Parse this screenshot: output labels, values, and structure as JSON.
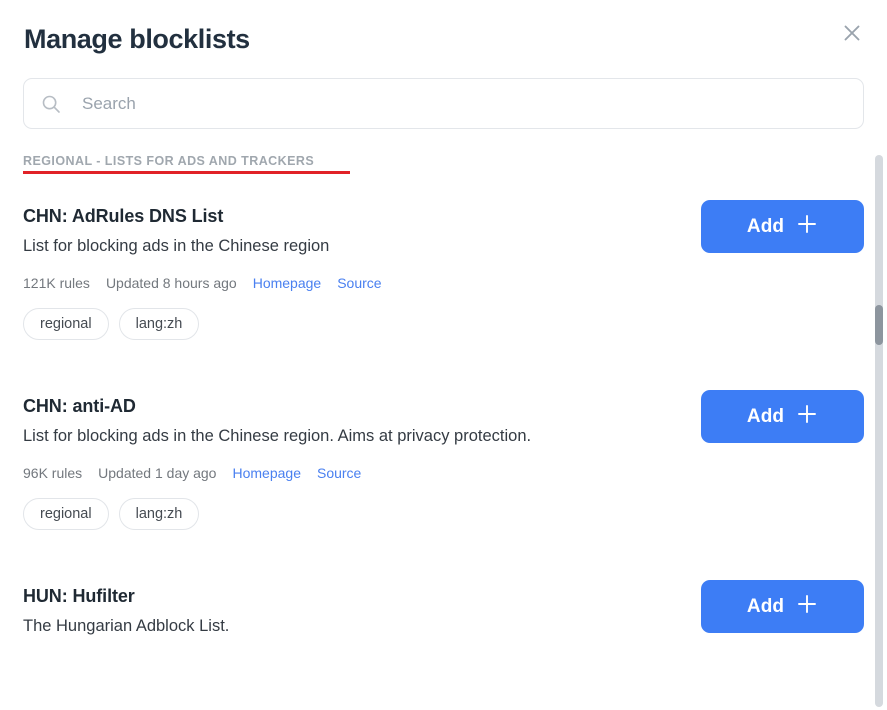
{
  "dialog": {
    "title": "Manage blocklists",
    "close_icon": "close-icon"
  },
  "search": {
    "icon": "search-icon",
    "placeholder": "Search",
    "value": ""
  },
  "section": {
    "label": "REGIONAL - LISTS FOR ADS AND TRACKERS",
    "underline_color": "#e12228"
  },
  "colors": {
    "accent_blue": "#3d7df5",
    "link_blue": "#4a80f0",
    "title_navy": "#22303f",
    "muted_gray": "#73787e",
    "section_gray": "#a0a7ae",
    "red_underline": "#e12228",
    "scrollbar_track": "#d5d9de",
    "scrollbar_thumb": "#8d959e"
  },
  "buttons": {
    "add_label": "Add",
    "add_icon": "plus-icon"
  },
  "lists": [
    {
      "title": "CHN: AdRules DNS List",
      "description": "List for blocking ads in the Chinese region",
      "rules": "121K rules",
      "updated": "Updated 8 hours ago",
      "homepage_label": "Homepage",
      "source_label": "Source",
      "tags": [
        "regional",
        "lang:zh"
      ],
      "action_label": "Add"
    },
    {
      "title": "CHN: anti-AD",
      "description": "List for blocking ads in the Chinese region. Aims at privacy protection.",
      "rules": "96K rules",
      "updated": "Updated 1 day ago",
      "homepage_label": "Homepage",
      "source_label": "Source",
      "tags": [
        "regional",
        "lang:zh"
      ],
      "action_label": "Add"
    },
    {
      "title": "HUN: Hufilter",
      "description": "The Hungarian Adblock List.",
      "rules": "",
      "updated": "",
      "homepage_label": "",
      "source_label": "",
      "tags": [],
      "action_label": "Add"
    }
  ]
}
